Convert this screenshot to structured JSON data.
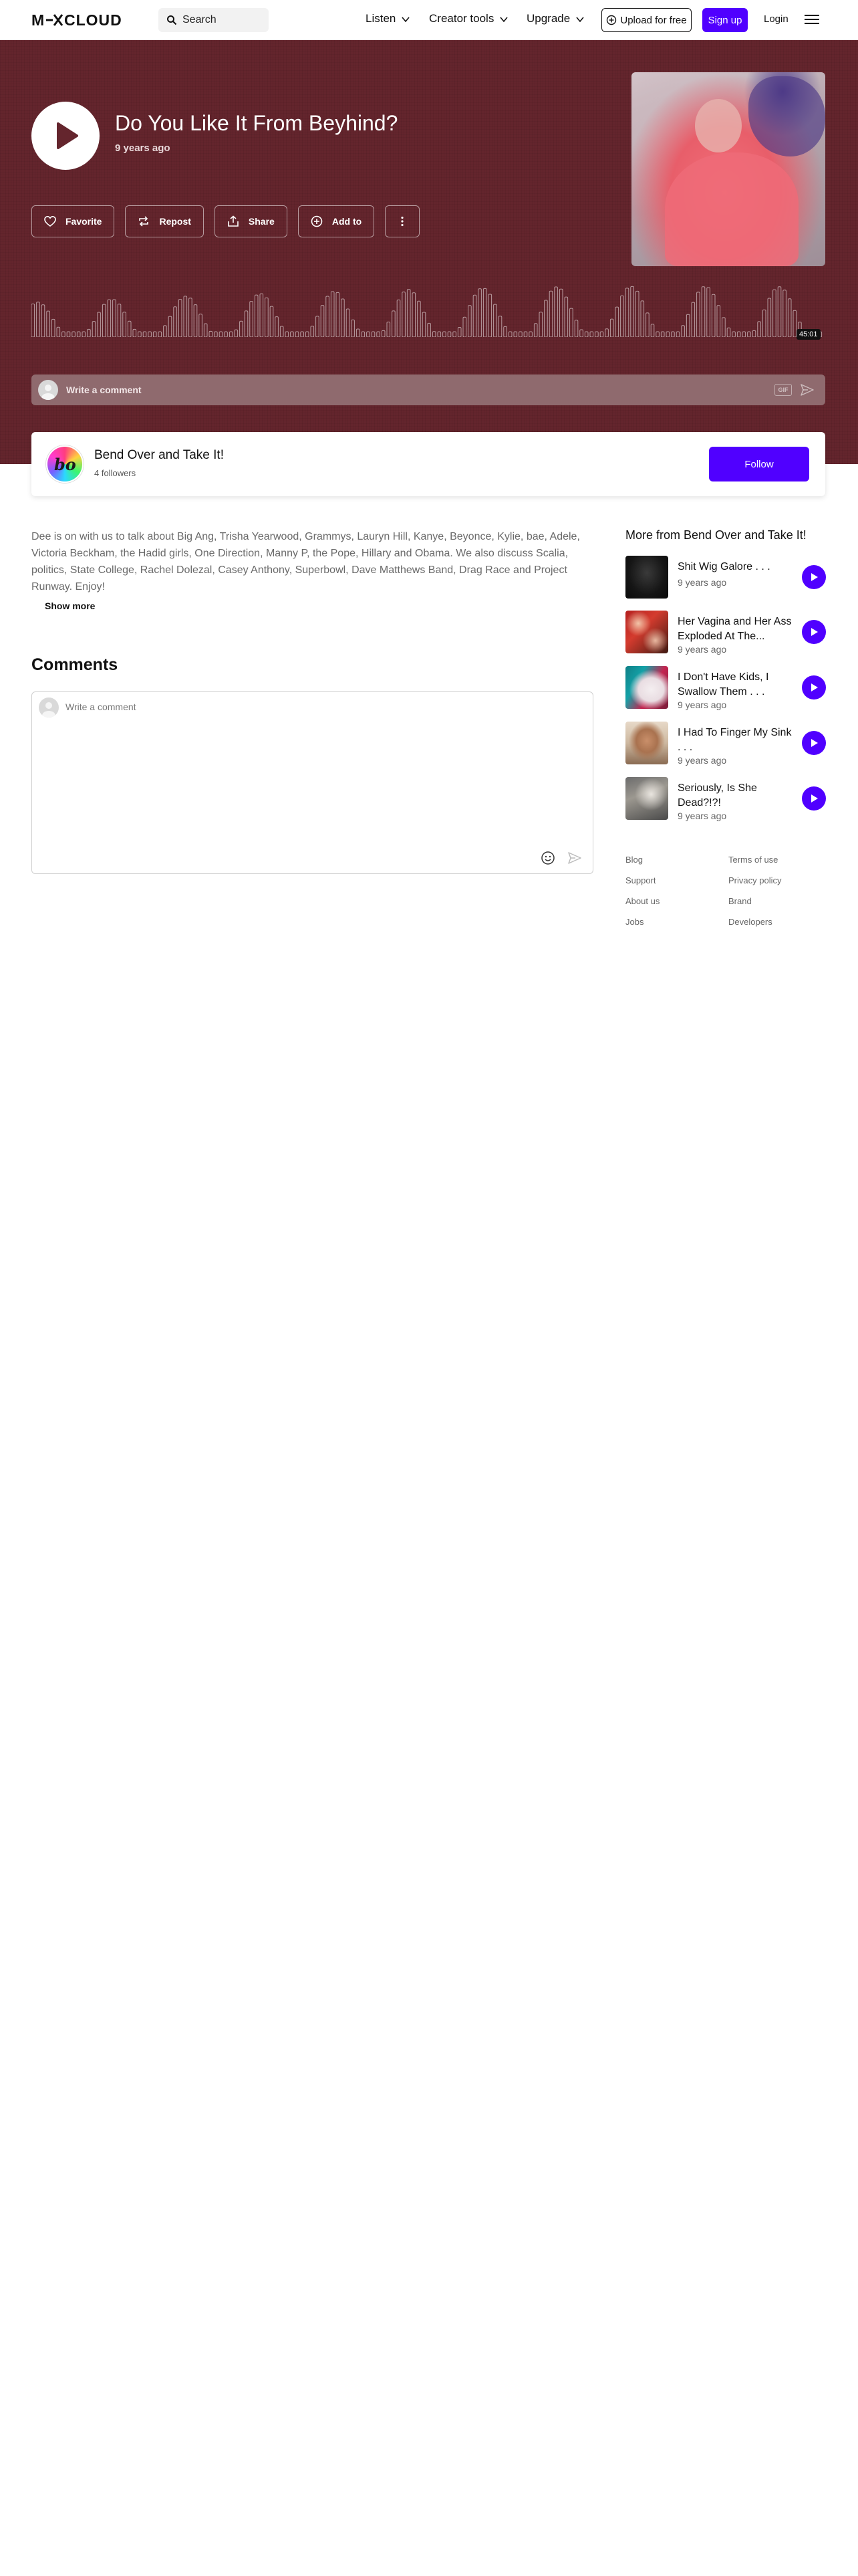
{
  "header": {
    "logo_text": "MIXCLOUD",
    "search_placeholder": "Search",
    "nav": [
      "Listen",
      "Creator tools",
      "Upgrade"
    ],
    "upload_label": "Upload for free",
    "signup_label": "Sign up",
    "login_label": "Login",
    "menu_icon": "hamburger-menu-icon",
    "accent_color": "#5000ff"
  },
  "show": {
    "title": "Do You Like It From Beyhind?",
    "age": "9 years ago",
    "duration": "45:01",
    "hero_color": "#64252d"
  },
  "actions": {
    "favorite": "Favorite",
    "repost": "Repost",
    "share": "Share",
    "add_to": "Add to"
  },
  "comment_bar": {
    "placeholder": "Write a comment",
    "gif_label": "GIF"
  },
  "artist": {
    "name": "Bend Over and Take It!",
    "followers": "4 followers",
    "follow_label": "Follow",
    "avatar_text": "bo"
  },
  "description": {
    "text": "Dee is on with us to talk about Big Ang, Trisha Yearwood, Grammys, Lauryn Hill, Kanye, Beyonce, Kylie, bae, Adele, Victoria Beckham, the Hadid girls, One Direction, Manny P, the Pope, Hillary and Obama. We also discuss Scalia, politics, State College, Rachel Dolezal, Casey Anthony, Superbowl, Dave Matthews Band, Drag Race and Project Runway. Enjoy!",
    "show_more": "Show more"
  },
  "comments": {
    "title": "Comments",
    "placeholder": "Write a comment"
  },
  "more_from": {
    "title": "More from Bend Over and Take It!",
    "items": [
      {
        "title": "Shit Wig Galore . . .",
        "age": "9 years ago"
      },
      {
        "title": "Her Vagina and Her Ass Exploded At The...",
        "age": "9 years ago"
      },
      {
        "title": "I Don't Have Kids, I Swallow Them . . .",
        "age": "9 years ago"
      },
      {
        "title": "I Had To Finger My Sink . . .",
        "age": "9 years ago"
      },
      {
        "title": "Seriously, Is She Dead?!?!",
        "age": "9 years ago"
      }
    ]
  },
  "footer": {
    "left": [
      "Blog",
      "Support",
      "About us",
      "Jobs"
    ],
    "right": [
      "Terms of use",
      "Privacy policy",
      "Brand",
      "Developers"
    ]
  }
}
